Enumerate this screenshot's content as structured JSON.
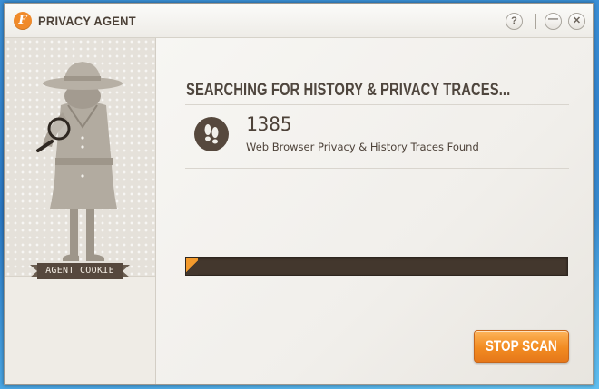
{
  "window": {
    "title": "PRIVACY AGENT",
    "logo_letter": "F",
    "help_label": "?",
    "minimize_label": "—",
    "close_label": "✕"
  },
  "sidebar": {
    "agent_name": "AGENT COOKIE"
  },
  "scan": {
    "heading": "SEARCHING FOR HISTORY & PRIVACY TRACES...",
    "count": "1385",
    "count_label": "Web Browser Privacy & History Traces Found",
    "progress": 0.03
  },
  "actions": {
    "stop_label": "STOP SCAN"
  },
  "icons": {
    "app_logo": "agent-logo-icon",
    "result": "footprints-icon",
    "agent": "spy-agent-illustration"
  },
  "colors": {
    "accent": "#f28b21",
    "dark_brown": "#56483d",
    "progress_track": "#43372d"
  }
}
